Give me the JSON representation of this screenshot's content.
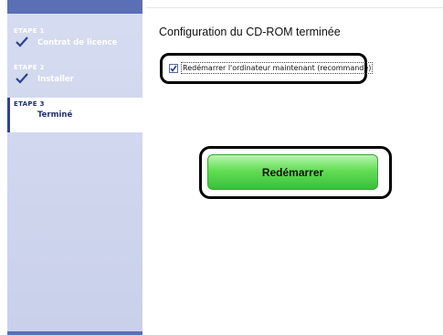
{
  "sidebar": {
    "steps": [
      {
        "number": "ETAPE 1",
        "label": "Contrat de licence",
        "status": "done"
      },
      {
        "number": "ETAPE 2",
        "label": "Installer",
        "status": "done"
      },
      {
        "number": "ETAPE 3",
        "label": "Terminé",
        "status": "current"
      }
    ]
  },
  "main": {
    "title": "Configuration du CD-ROM terminée",
    "restart_checkbox": {
      "label": "Redémarrer l'ordinateur maintenant (recommandé)",
      "checked": true
    },
    "restart_button_label": "Redémarrer"
  },
  "colors": {
    "sidebar_accent": "#5a6fb5",
    "button_green": "#63de55",
    "highlight_border": "#000000"
  }
}
